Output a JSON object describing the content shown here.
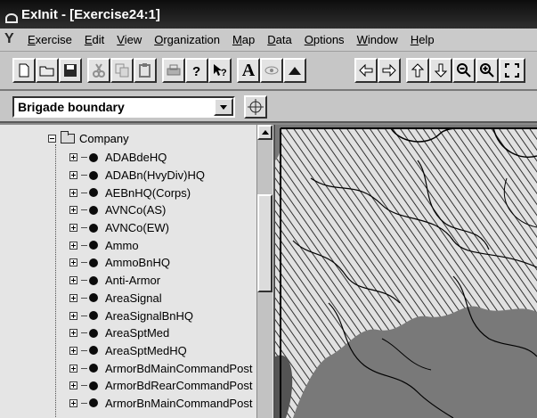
{
  "window": {
    "title": "ExInit - [Exercise24:1]"
  },
  "menu": [
    "Exercise",
    "Edit",
    "View",
    "Organization",
    "Map",
    "Data",
    "Options",
    "Window",
    "Help"
  ],
  "toolbar": {
    "text_tool_label": "A",
    "buttons": [
      "new-file",
      "open-folder",
      "save",
      "cut",
      "copy",
      "paste",
      "print",
      "help",
      "context-help",
      "text-tool",
      "eye-tool",
      "fill-tool",
      "left-arrow",
      "right-arrow",
      "up-arrow",
      "down-arrow",
      "zoom-out",
      "zoom-in",
      "fit-extent"
    ]
  },
  "layer_select": {
    "value": "Brigade boundary"
  },
  "tree": {
    "root_label": "Company",
    "items": [
      "ADABdeHQ",
      "ADABn(HvyDiv)HQ",
      "AEBnHQ(Corps)",
      "AVNCo(AS)",
      "AVNCo(EW)",
      "Ammo",
      "AmmoBnHQ",
      "Anti-Armor",
      "AreaSignal",
      "AreaSignalBnHQ",
      "AreaSptMed",
      "AreaSptMedHQ",
      "ArmorBdMainCommandPost",
      "ArmorBdRearCommandPost",
      "ArmorBnMainCommandPost"
    ]
  },
  "colors": {
    "titlebar": "#2a2a2a",
    "chrome": "#c0c0c0",
    "tree_bg": "#d8d8d8",
    "map_bg": "#6e6e6e"
  }
}
